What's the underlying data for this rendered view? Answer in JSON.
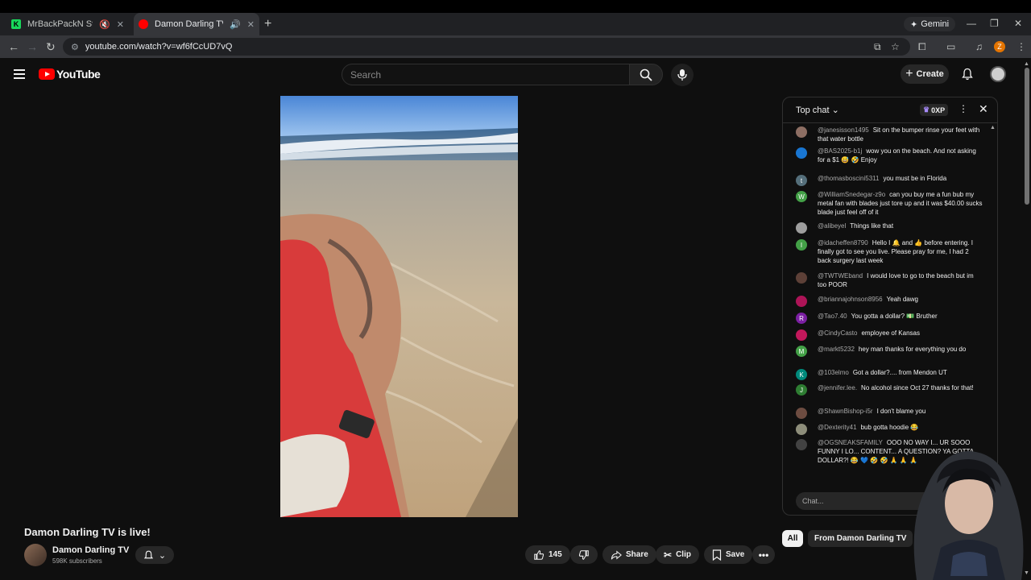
{
  "browser": {
    "tabs": [
      {
        "title": "MrBackPackN Stream - Wat",
        "favicon_color": "#18d85b",
        "active": false
      },
      {
        "title": "Damon Darling TV is live! -",
        "favicon_color": "#ff0000",
        "active": true
      }
    ],
    "new_tab": "+",
    "gemini_label": "Gemini",
    "url": "youtube.com/watch?v=wf6fCcUD7vQ",
    "profile_initial": "Z"
  },
  "masthead": {
    "logo_text": "YouTube",
    "search_placeholder": "Search",
    "create_label": "Create"
  },
  "video": {
    "title": "Damon Darling TV is live!",
    "channel_name": "Damon Darling TV",
    "subscribers": "598K subscribers",
    "like_count": "145",
    "share_label": "Share",
    "clip_label": "Clip",
    "save_label": "Save"
  },
  "chat": {
    "mode_label": "Top chat",
    "xp_label": "0XP",
    "input_placeholder": "Chat...",
    "messages": [
      {
        "author": "@janesisson1495",
        "text": "Sit on the bumper rinse your feet with that water bottle",
        "avatar": "",
        "color": "#8d6e63"
      },
      {
        "author": "@BAS2025-b1j",
        "text": "wow you on the beach. And not asking for a $1 😅 🤣 Enjoy",
        "avatar": "",
        "color": "#1976d2"
      },
      {
        "author": "@thomasboscini5311",
        "text": "you must be in Florida",
        "avatar": "t",
        "color": "#546e7a"
      },
      {
        "author": "@WilliamSnedegar-z9o",
        "text": "can you buy me a fun bub my metal fan with blades just tore up and it was $40.00 sucks blade just feel off of it",
        "avatar": "W",
        "color": "#43a047"
      },
      {
        "author": "@alibeyel",
        "text": "Things like that",
        "avatar": "",
        "color": "#9e9e9e"
      },
      {
        "author": "@idacheffen8790",
        "text": "Hello I 🔔 and 👍 before entering. I finally got to see you live. Please pray for me, I had 2 back surgery last week",
        "avatar": "I",
        "color": "#43a047"
      },
      {
        "author": "@TWTWEband",
        "text": "I would love to go to the beach but im too POOR",
        "avatar": "",
        "color": "#5d4037"
      },
      {
        "author": "@briannajohnson8956",
        "text": "Yeah dawg",
        "avatar": "",
        "color": "#ad1457"
      },
      {
        "author": "@Tao7.40",
        "text": "You gotta a dollar? 💵 Bruther",
        "avatar": "R",
        "color": "#7b1fa2"
      },
      {
        "author": "@CindyCasto",
        "text": "employee of Kansas",
        "avatar": "",
        "color": "#c2185b"
      },
      {
        "author": "@markt5232",
        "text": "hey man thanks for everything you do",
        "avatar": "M",
        "color": "#43a047"
      },
      {
        "author": "@103elmo",
        "text": "Got a dollar?.... from Mendon UT",
        "avatar": "K",
        "color": "#00897b"
      },
      {
        "author": "@jennifer.lee.",
        "text": "No alcohol since Oct 27 thanks for that!",
        "avatar": "J",
        "color": "#2e7d32"
      },
      {
        "author": "@ShawnBishop-i5r",
        "text": "I don't blame you",
        "avatar": "",
        "color": "#6d4c41"
      },
      {
        "author": "@Dexterity41",
        "text": "bub gotta hoodie 😂",
        "avatar": "",
        "color": "#8d8d7a"
      },
      {
        "author": "@OGSNEAKSFAMILY",
        "text": "OOO NO WAY I... UR SOOO FUNNY I LO... CONTENT... A QUESTION? YA GOTTA DOLLAR?! 😂 💙 🤣 🤣 🙏 🙏 🙏",
        "avatar": "",
        "color": "#424242"
      }
    ]
  },
  "chips": {
    "all": "All",
    "from_channel": "From Damon Darling TV"
  },
  "colors": {
    "background": "#0f0f0f",
    "accent_red": "#ff0000",
    "surface": "#272727"
  }
}
